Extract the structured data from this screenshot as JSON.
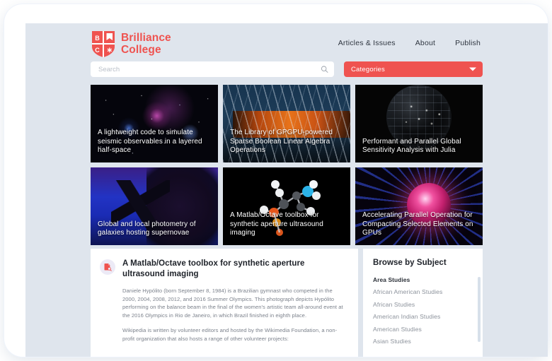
{
  "brand": {
    "name_line1": "Brilliance",
    "name_line2": "College",
    "shield_letter_1": "B",
    "shield_letter_2": "C",
    "shield_mark": "✳",
    "accent_color": "#ef5350"
  },
  "nav": {
    "items": [
      {
        "label": "Articles & Issues"
      },
      {
        "label": "About"
      },
      {
        "label": "Publish"
      }
    ]
  },
  "search": {
    "placeholder": "Search",
    "value": "",
    "icon": "search-icon"
  },
  "categories": {
    "label": "Categories",
    "icon": "chevron-down-icon"
  },
  "cards": [
    {
      "title": "A lightweight code to simulate seismic observables in a layered half-space",
      "art": "nebula-space-image"
    },
    {
      "title": "The Library of GPGPU-powered Sparse Boolean Linear Algebra Operations",
      "art": "stadium-architecture-image"
    },
    {
      "title": "Performant and Parallel Global Sensitivity Analysis with Julia",
      "art": "dark-globe-image"
    },
    {
      "title": "Global and local photometry of galaxies hosting supernovae",
      "art": "microscope-silhouette-image"
    },
    {
      "title": "A Matlab/Octave toolbox for synthetic aperture ultrasound imaging",
      "art": "molecule-model-image"
    },
    {
      "title": "Accelerating Parallel Operation for Compacting Selected Elements on GPUs",
      "art": "plasma-sphere-image"
    }
  ],
  "article": {
    "icon": "document-search-icon",
    "title": "A Matlab/Octave toolbox for synthetic aperture ultrasound imaging",
    "paragraphs": [
      "Daniele Hypólito (born September 8, 1984) is a Brazilian gymnast who competed in the 2000, 2004, 2008, 2012, and 2016 Summer Olympics. This photograph depicts Hypólito performing on the balance beam in the final of the women's artistic team all-around event at the 2016 Olympics in Rio de Janeiro, in which Brazil finished in eighth place.",
      "Wikipedia is written by volunteer editors and hosted by the Wikimedia Foundation, a non-profit organization that also hosts a range of other volunteer projects:"
    ]
  },
  "subjects": {
    "title": "Browse by Subject",
    "group": "Area Studies",
    "items": [
      {
        "label": "African American Studies"
      },
      {
        "label": "African Studies"
      },
      {
        "label": "American Indian Studies"
      },
      {
        "label": "American Studies"
      },
      {
        "label": "Asian Studies"
      }
    ]
  }
}
